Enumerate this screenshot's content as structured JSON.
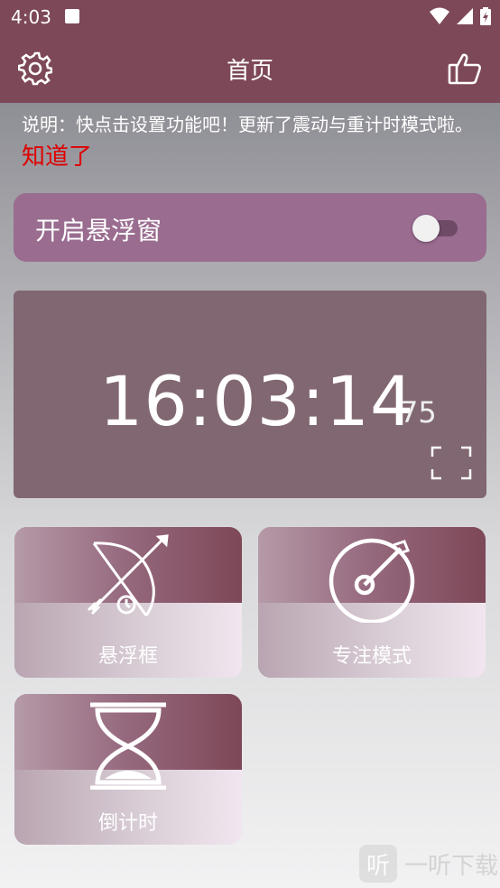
{
  "status": {
    "time": "4:03"
  },
  "appbar": {
    "title": "首页"
  },
  "notice": {
    "text": "说明：快点击设置功能吧！更新了震动与重计时模式啦。",
    "ok_label": "知道了"
  },
  "floating_window": {
    "label": "开启悬浮窗",
    "enabled": false
  },
  "clock": {
    "time": "16:03:14",
    "ms": "75"
  },
  "tiles": [
    {
      "label": "悬浮框",
      "icon": "bow-arrow-icon"
    },
    {
      "label": "专注模式",
      "icon": "target-dart-icon"
    },
    {
      "label": "倒计时",
      "icon": "hourglass-icon"
    }
  ],
  "watermark": {
    "icon_text": "听",
    "text": "一听下载"
  },
  "colors": {
    "primary": "#7d4857",
    "accent_alert": "#e00000",
    "float_card": "#9a6c90",
    "clock_card": "#806771"
  }
}
